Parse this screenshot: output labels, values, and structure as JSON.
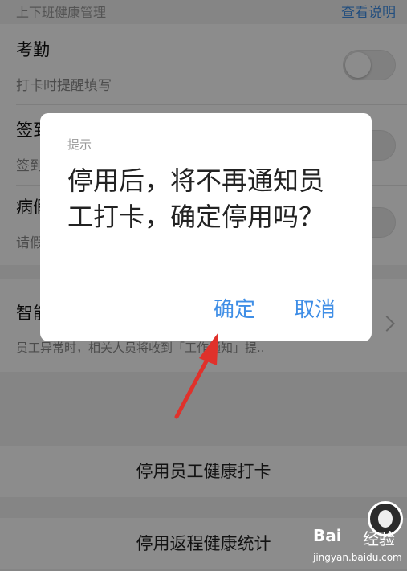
{
  "header": {
    "title": "上下班健康管理",
    "link": "查看说明"
  },
  "rows": [
    {
      "title": "考勤",
      "subtitle": "打卡时提醒填写"
    },
    {
      "title": "签到",
      "subtitle": "签到时提醒填写"
    },
    {
      "title": "病假",
      "subtitle": "请假时提醒填写"
    }
  ],
  "smart_row": {
    "title": "智能提醒",
    "subtitle": "员工异常时，相关人员将收到「工作通知」提.."
  },
  "actions": {
    "disable_checkin": "停用员工健康打卡",
    "disable_return": "停用返程健康统计"
  },
  "dialog": {
    "title": "提示",
    "message": "停用后，将不再通知员工打卡，确定停用吗？",
    "confirm": "确定",
    "cancel": "取消"
  },
  "watermark": {
    "brand": "Bai",
    "name": "经验",
    "url": "jingyan.baidu.com"
  },
  "colors": {
    "accent": "#3f8ee6",
    "annotation": "#e0312b"
  }
}
